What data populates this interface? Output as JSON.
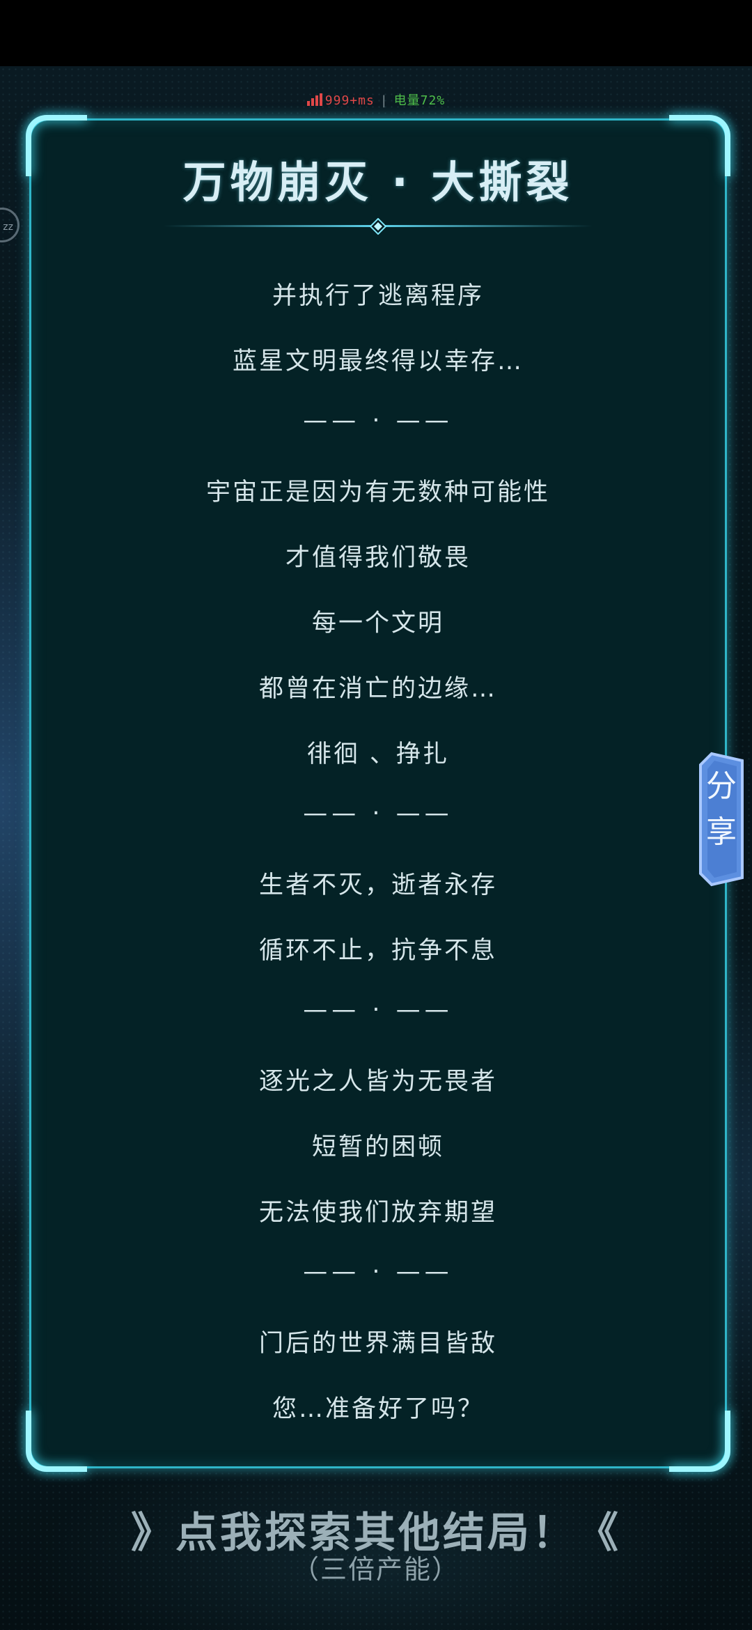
{
  "status": {
    "ping": "999+ms",
    "separator": "|",
    "battery": "电量72%"
  },
  "panel": {
    "title": "万物崩灭 · 大撕裂",
    "lines": [
      "并执行了逃离程序",
      "蓝星文明最终得以幸存…",
      "—— · ——",
      "宇宙正是因为有无数种可能性",
      "才值得我们敬畏",
      "每一个文明",
      "都曾在消亡的边缘…",
      "徘徊 、挣扎",
      "—— · ——",
      "生者不灭，逝者永存",
      "循环不止，抗争不息",
      "—— · ——",
      "逐光之人皆为无畏者",
      "短暂的困顿",
      "无法使我们放弃期望",
      "—— · ——",
      "门后的世界满目皆敌",
      "您…准备好了吗？"
    ]
  },
  "share": {
    "label_1": "分",
    "label_2": "享"
  },
  "float_button": {
    "label": "zz"
  },
  "explore": {
    "label": "》点我探索其他结局！《",
    "sub": "（三倍产能）"
  },
  "colors": {
    "panel_bg": "#042226",
    "panel_border": "#2fb5c8",
    "text": "#d6e6ea",
    "ping": "#e04848",
    "battery": "#4fbf4a",
    "share_tab": "#5c8fe0"
  }
}
